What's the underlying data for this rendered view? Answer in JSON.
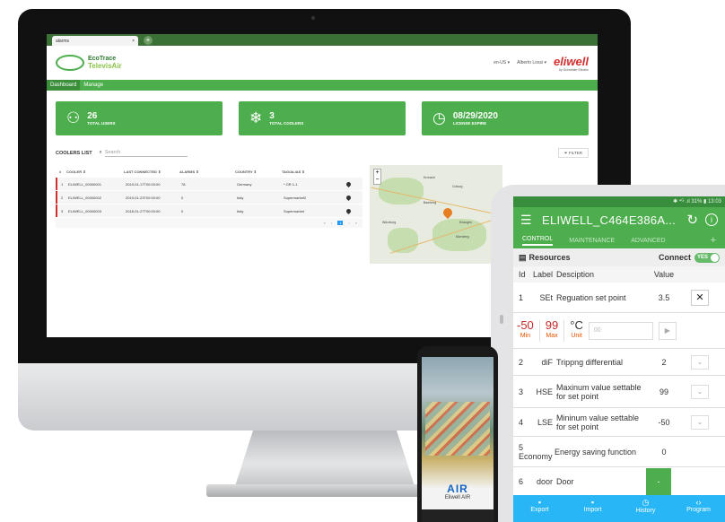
{
  "browser": {
    "tab_title": "alarms",
    "tab_close": "×",
    "new_tab": "+"
  },
  "header": {
    "brand_top": "EcoTrace",
    "brand_name": "TelevisAir",
    "language": "en-US ▾",
    "user": "Alberto Lossi ▾",
    "vendor_logo": "eliwell",
    "vendor_sub": "by Schneider Electric"
  },
  "nav": {
    "items": [
      {
        "label": "Dashboard"
      },
      {
        "label": "Manage"
      }
    ]
  },
  "cards": [
    {
      "icon": "users-icon",
      "value": "26",
      "label": "TOTAL USERS"
    },
    {
      "icon": "cooler-icon",
      "value": "3",
      "label": "TOTAL COOLERS"
    },
    {
      "icon": "clock-icon",
      "value": "08/29/2020",
      "label": "LICENSE EXPIRE"
    }
  ],
  "coolers": {
    "title": "COOLERS LIST",
    "search_placeholder": "Search",
    "filter_label": "FILTER",
    "columns": [
      "#",
      "COOLER ⇕",
      "LAST CONNECTED ⇕",
      "ALARMS ⇕",
      "COUNTRY ⇕",
      "TAG/ALIAS ⇕"
    ],
    "rows": [
      {
        "n": "1",
        "cooler": "ELIWELL_00000001",
        "last": "2019-01-17T00:00:00",
        "alarms": "78",
        "country": "Germany",
        "tag": "* OR 1-1"
      },
      {
        "n": "2",
        "cooler": "ELIWELL_00000002",
        "last": "2019-01-23T00:00:00",
        "alarms": "0",
        "country": "Italy",
        "tag": "Supermarket2"
      },
      {
        "n": "3",
        "cooler": "ELIWELL_00000003",
        "last": "2018-01-27T00:00:00",
        "alarms": "0",
        "country": "Italy",
        "tag": "Supermarket"
      }
    ],
    "pager": [
      "«",
      "‹",
      "1",
      "›",
      "»"
    ]
  },
  "map": {
    "zoom_in": "+",
    "zoom_out": "−",
    "towns": [
      "Kronach",
      "Coburg",
      "Bamberg",
      "Würzburg",
      "Erlangen",
      "Nürnberg"
    ]
  },
  "tablet": {
    "status": "✱ ⁴ᴳ .ıl 31% ▮ 13:03",
    "title": "ELIWELL_C464E386A...",
    "tabs": [
      "CONTROL",
      "MAINTENANCE",
      "ADVANCED"
    ],
    "tab_plus": "+",
    "resources_label": "Resources",
    "connect_label": "Connect",
    "toggle_label": "YES",
    "columns": [
      "Id",
      "Label",
      "Desciption",
      "Value"
    ],
    "row1": {
      "id": "1",
      "label": "SEt",
      "desc": "Reguation set point",
      "value": "3.5",
      "action": "✕"
    },
    "edit": {
      "min_value": "-50",
      "min_label": "Min",
      "max_value": "99",
      "max_label": "Max",
      "unit_value": "°C",
      "unit_label": "Unit",
      "input_placeholder": "00",
      "send": "▶"
    },
    "rows": [
      {
        "id": "2",
        "label": "diF",
        "desc": "Trippng differential",
        "value": "2"
      },
      {
        "id": "3",
        "label": "HSE",
        "desc": "Maxinum value settable for set point",
        "value": "99"
      },
      {
        "id": "4",
        "label": "LSE",
        "desc": "Mininum value settable for set point",
        "value": "-50"
      },
      {
        "id": "5",
        "label": "Economy",
        "desc": "Energy saving function",
        "value": "0"
      },
      {
        "id": "6",
        "label": "door",
        "desc": "Door",
        "value": "-"
      }
    ],
    "bottom": [
      {
        "icon": "▪",
        "label": "Export"
      },
      {
        "icon": "▪",
        "label": "Import"
      },
      {
        "icon": "◷",
        "label": "History"
      },
      {
        "icon": "‹›",
        "label": "Program"
      }
    ]
  },
  "phone": {
    "brand": "AIR",
    "sub": "Eliwell AIR"
  }
}
